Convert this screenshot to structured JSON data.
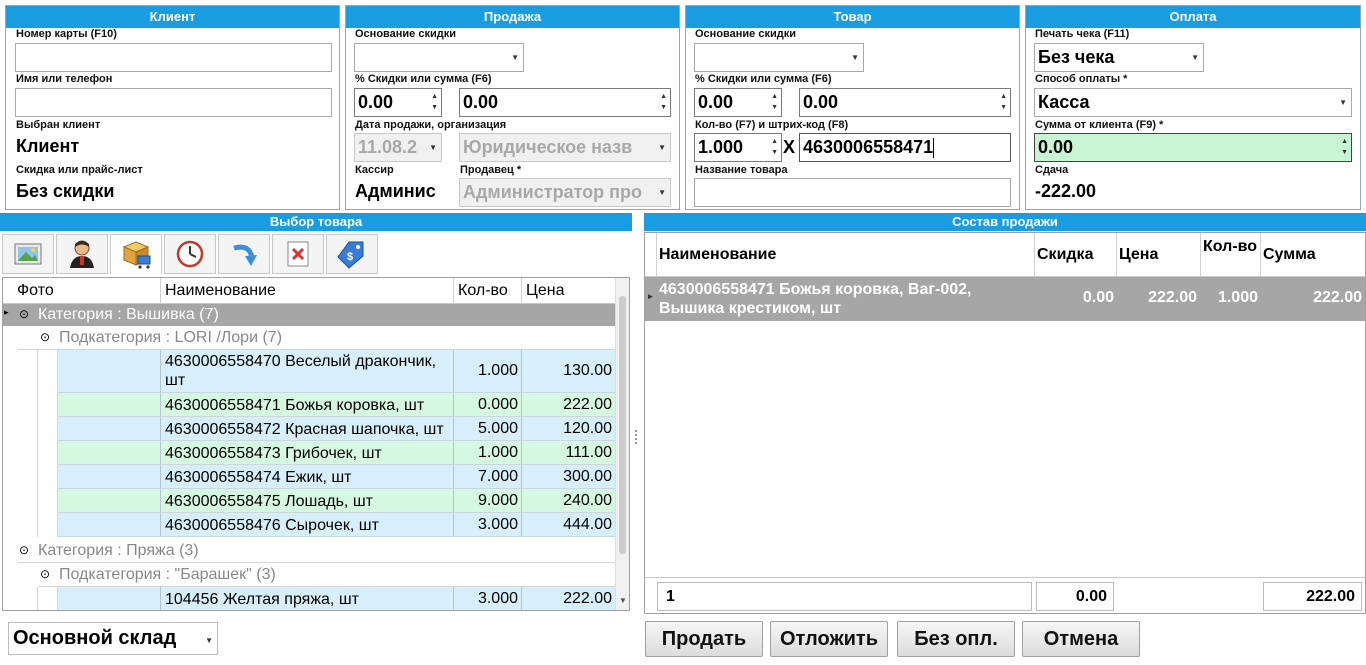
{
  "client": {
    "title": "Клиент",
    "card_label": "Номер карты (F10)",
    "card_value": "",
    "name_label": "Имя или телефон",
    "name_value": "",
    "selected_label": "Выбран клиент",
    "selected_value": "Клиент",
    "discount_label": "Скидка или прайс-лист",
    "discount_value": "Без скидки"
  },
  "sale": {
    "title": "Продажа",
    "basis_label": "Основание скидки",
    "basis_value": "",
    "pct_label": "% Скидки или сумма (F6)",
    "pct_value": "0.00",
    "sum_value": "0.00",
    "date_label": "Дата продажи, организация",
    "date_value": "11.08.2",
    "org_value": "Юридическое назв",
    "cashier_label": "Кассир",
    "cashier_value": "Админис",
    "seller_label": "Продавец *",
    "seller_value": "Администратор про"
  },
  "product": {
    "title": "Товар",
    "basis_label": "Основание скидки",
    "basis_value": "",
    "pct_label": "% Скидки или сумма (F6)",
    "pct_value": "0.00",
    "sum_value": "0.00",
    "qty_label": "Кол-во (F7) и штрих-код (F8)",
    "qty_value": "1.000",
    "x_sign": "X",
    "barcode_value": "4630006558471",
    "name_label": "Название товара",
    "name_value": ""
  },
  "payment": {
    "title": "Оплата",
    "print_label": "Печать чека (F11)",
    "print_value": "Без чека",
    "method_label": "Способ оплаты *",
    "method_value": "Касса",
    "client_sum_label": "Сумма от клиента (F9) *",
    "client_sum_value": "0.00",
    "change_label": "Сдача",
    "change_value": "-222.00"
  },
  "catalog": {
    "title": "Выбор товара",
    "toolbar_icons": [
      "photo-icon",
      "user-icon",
      "product-cart-icon",
      "clock-icon",
      "return-arrow-icon",
      "cancel-document-icon",
      "price-tag-icon"
    ],
    "columns": [
      "Фото",
      "Наименование",
      "Кол-во",
      "Цена"
    ],
    "category1": "Категория : Вышивка (7)",
    "subcategory1": "Подкатегория : LORI /Лори (7)",
    "rows1": [
      {
        "name": "4630006558470 Веселый дракончик, шт",
        "qty": "1.000",
        "price": "130.00"
      },
      {
        "name": "4630006558471 Божья коровка, шт",
        "qty": "0.000",
        "price": "222.00"
      },
      {
        "name": "4630006558472 Красная шапочка, шт",
        "qty": "5.000",
        "price": "120.00"
      },
      {
        "name": "4630006558473 Грибочек, шт",
        "qty": "1.000",
        "price": "111.00"
      },
      {
        "name": "4630006558474 Ежик, шт",
        "qty": "7.000",
        "price": "300.00"
      },
      {
        "name": "4630006558475 Лошадь, шт",
        "qty": "9.000",
        "price": "240.00"
      },
      {
        "name": "4630006558476 Сырочек, шт",
        "qty": "3.000",
        "price": "444.00"
      }
    ],
    "category2": "Категория : Пряжа (3)",
    "subcategory2": "Подкатегория : \"Барашек\" (3)",
    "rows2": [
      {
        "name": "104456 Желтая пряжа, шт",
        "qty": "3.000",
        "price": "222.00"
      }
    ],
    "warehouse": "Основной склад"
  },
  "composition": {
    "title": "Состав продажи",
    "columns": [
      "Наименование",
      "Скидка",
      "Цена",
      "Кол-во",
      "Сумма"
    ],
    "rows": [
      {
        "name": "4630006558471 Божья коровка, Ваг-002, Вышика крестиком, шт",
        "discount": "0.00",
        "price": "222.00",
        "qty": "1.000",
        "sum": "222.00"
      }
    ],
    "footer_count": "1",
    "footer_discount": "0.00",
    "footer_sum": "222.00"
  },
  "actions": {
    "sell": "Продать",
    "defer": "Отложить",
    "no_pay": "Без опл.",
    "cancel": "Отмена"
  }
}
